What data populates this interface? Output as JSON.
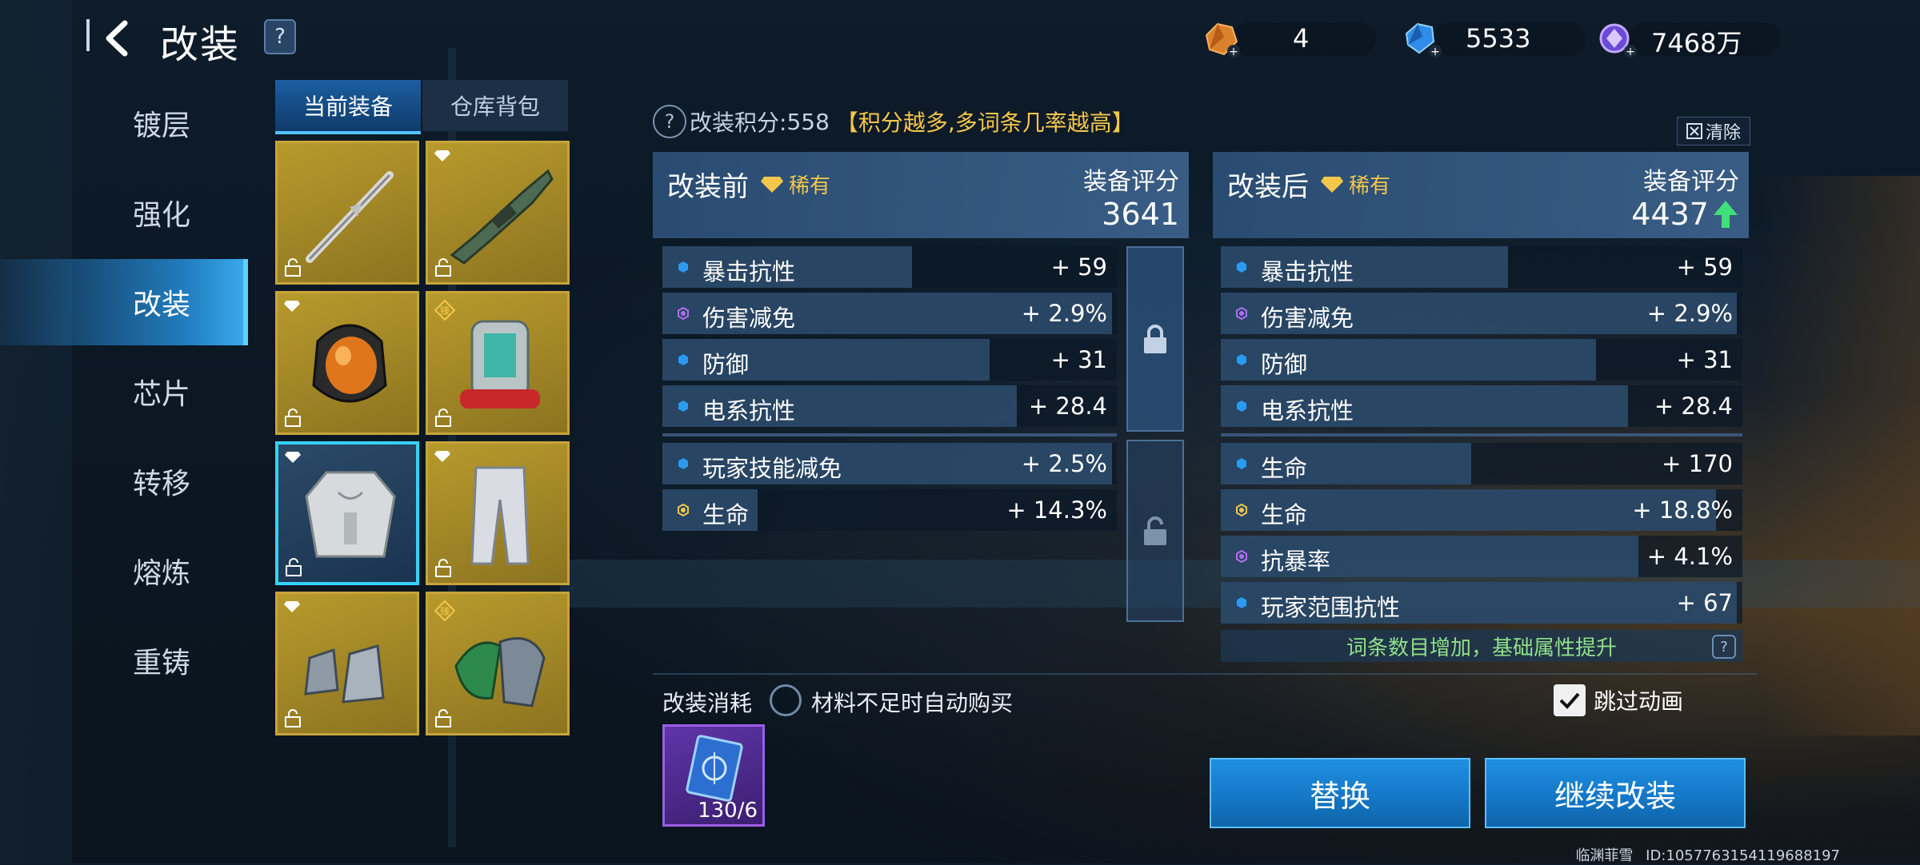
{
  "header": {
    "title": "改装",
    "help": "?",
    "currencies": [
      {
        "icon": "orange-crystal-icon",
        "value": "4"
      },
      {
        "icon": "blue-gem-icon",
        "value": "5533"
      },
      {
        "icon": "purple-coin-icon",
        "value": "7468万"
      }
    ]
  },
  "sidebar": {
    "items": [
      {
        "label": "镀层"
      },
      {
        "label": "强化"
      },
      {
        "label": "改装",
        "active": true
      },
      {
        "label": "芯片"
      },
      {
        "label": "转移"
      },
      {
        "label": "熔炼"
      },
      {
        "label": "重铸"
      }
    ]
  },
  "equipment_tabs": {
    "current": "当前装备",
    "warehouse": "仓库背包"
  },
  "equipment_slots": [
    {
      "item": "blade-weapon",
      "badge": "none",
      "selected": false
    },
    {
      "item": "rifle-weapon",
      "badge": "diamond",
      "selected": false
    },
    {
      "item": "helmet",
      "badge": "diamond",
      "selected": false
    },
    {
      "item": "backpack",
      "badge": "臻",
      "selected": false
    },
    {
      "item": "chest-armor",
      "badge": "diamond",
      "selected": true
    },
    {
      "item": "leg-armor",
      "badge": "diamond",
      "selected": false
    },
    {
      "item": "boots",
      "badge": "diamond",
      "selected": false
    },
    {
      "item": "gloves",
      "badge": "臻",
      "selected": false
    }
  ],
  "score_info": {
    "prefix": "改装积分:",
    "value": "558",
    "note": "【积分越多,多词条几率越高】",
    "clear": "清除"
  },
  "before": {
    "title": "改装前",
    "rarity": "稀有",
    "score_label": "装备评分",
    "score": "3641",
    "stats_main": [
      {
        "name": "暴击抗性",
        "value": "+ 59",
        "dot": "blue",
        "fill": 0.55
      },
      {
        "name": "伤害减免",
        "value": "+ 2.9%",
        "dot": "purple",
        "fill": 0.99
      },
      {
        "name": "防御",
        "value": "+ 31",
        "dot": "blue",
        "fill": 0.72
      },
      {
        "name": "电系抗性",
        "value": "+ 28.4",
        "dot": "blue",
        "fill": 0.78
      }
    ],
    "stats_extra": [
      {
        "name": "玩家技能减免",
        "value": "+ 2.5%",
        "dot": "blue",
        "fill": 0.99
      },
      {
        "name": "生命",
        "value": "+ 14.3%",
        "dot": "gold",
        "fill": 0.21
      }
    ]
  },
  "after": {
    "title": "改装后",
    "rarity": "稀有",
    "score_label": "装备评分",
    "score": "4437",
    "stats_main": [
      {
        "name": "暴击抗性",
        "value": "+ 59",
        "dot": "blue",
        "fill": 0.55
      },
      {
        "name": "伤害减免",
        "value": "+ 2.9%",
        "dot": "purple",
        "fill": 0.99
      },
      {
        "name": "防御",
        "value": "+ 31",
        "dot": "blue",
        "fill": 0.72
      },
      {
        "name": "电系抗性",
        "value": "+ 28.4",
        "dot": "blue",
        "fill": 0.78
      }
    ],
    "stats_extra": [
      {
        "name": "生命",
        "value": "+ 170",
        "dot": "blue",
        "fill": 0.48
      },
      {
        "name": "生命",
        "value": "+ 18.8%",
        "dot": "gold",
        "fill": 0.95
      },
      {
        "name": "抗暴率",
        "value": "+ 4.1%",
        "dot": "purple",
        "fill": 0.8
      },
      {
        "name": "玩家范围抗性",
        "value": "+ 67",
        "dot": "blue",
        "fill": 0.99
      }
    ],
    "hint": "词条数目增加，基础属性提升"
  },
  "cost": {
    "label": "改装消耗",
    "auto_buy": "材料不足时自动购买",
    "material_count": "130/6"
  },
  "skip_animation": {
    "label": "跳过动画",
    "checked": true
  },
  "buttons": {
    "replace": "替换",
    "continue": "继续改装"
  },
  "footer": {
    "player": "临渊菲雪",
    "id": "ID:1057763154119688197"
  },
  "colors": {
    "accent": "#1f8fe0",
    "rarity": "#f4c64a",
    "slot_gold": "#b79a2c",
    "selected_border": "#36d1ff",
    "hint_green": "#8ee08a"
  }
}
